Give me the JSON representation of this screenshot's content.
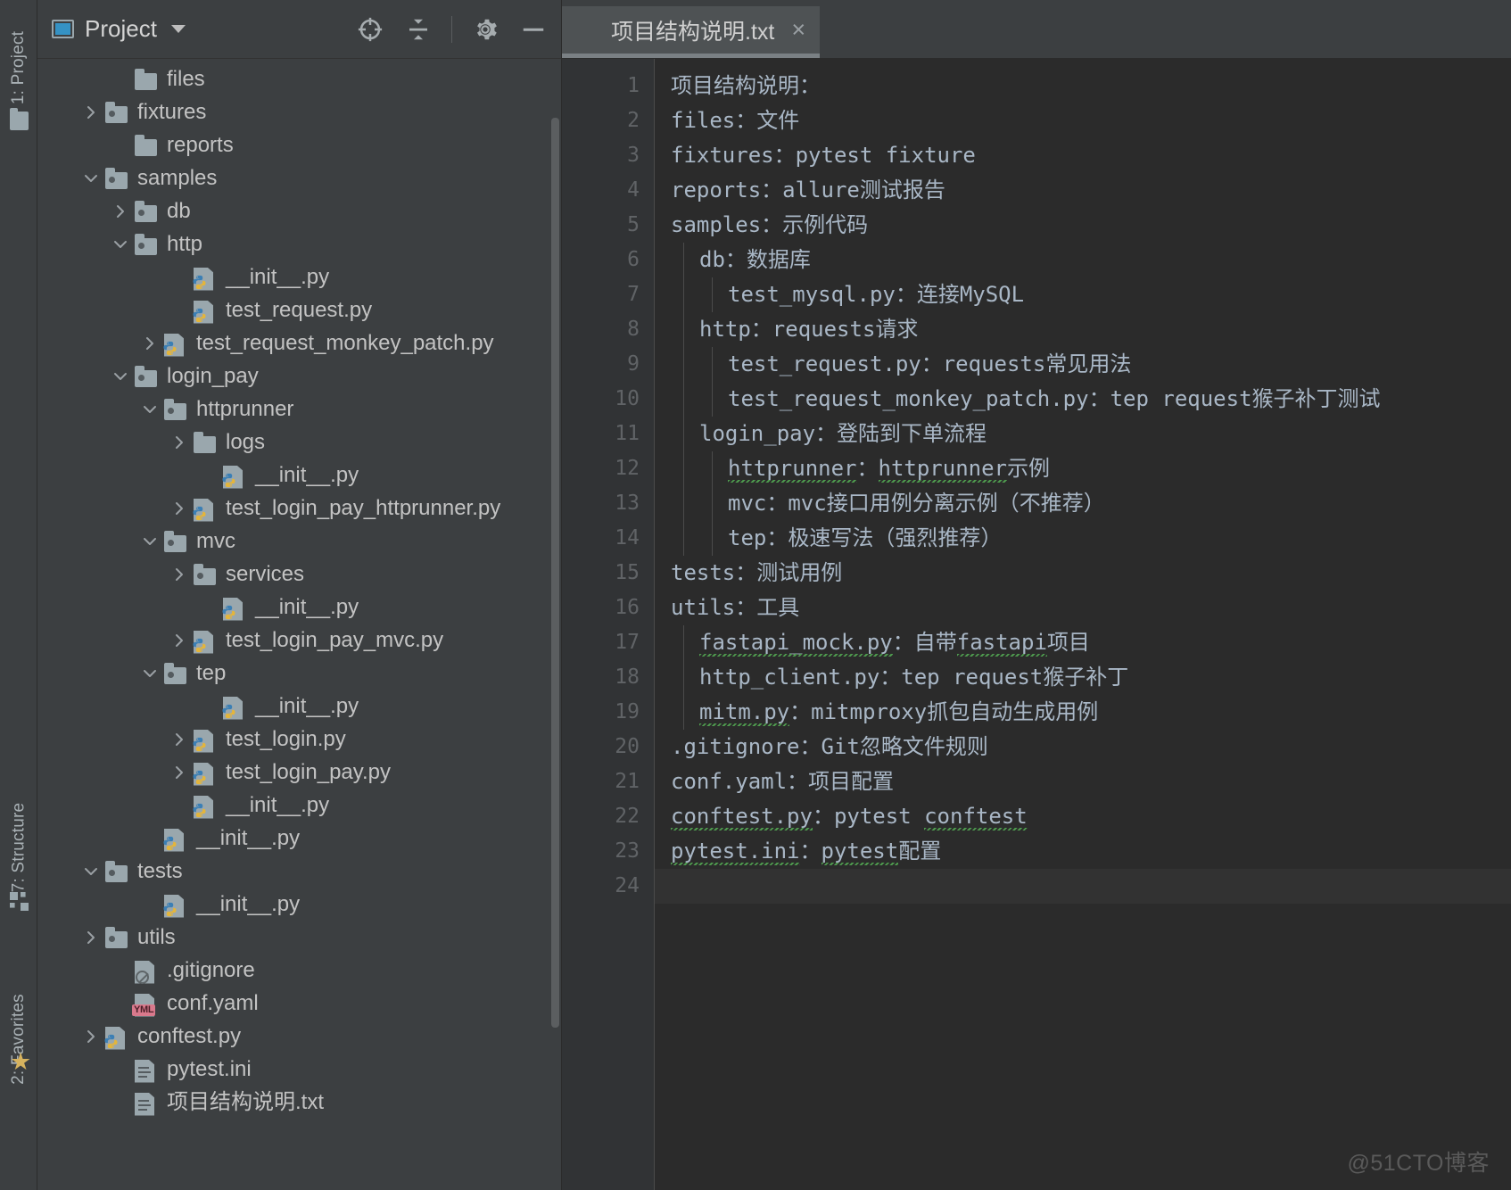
{
  "toolstrip": {
    "tabs": [
      {
        "id": "project",
        "label": "1: Project",
        "icon": "folder-icon"
      },
      {
        "id": "structure",
        "label": "7: Structure",
        "icon": "structure-icon"
      },
      {
        "id": "favorites",
        "label": "2: Favorites",
        "icon": "star-icon"
      }
    ]
  },
  "project_panel": {
    "title": "Project",
    "title_icon": "project-window-icon",
    "dropdown_icon": "chevron-down-icon",
    "actions": [
      {
        "id": "locate",
        "name": "select-opened-file-icon",
        "tooltip": "Select Opened File"
      },
      {
        "id": "collapse",
        "name": "collapse-all-icon",
        "tooltip": "Collapse All"
      },
      {
        "id": "settings",
        "name": "gear-icon",
        "tooltip": "Settings"
      },
      {
        "id": "hide",
        "name": "minimize-icon",
        "tooltip": "Hide"
      }
    ],
    "tree": [
      {
        "label": "files",
        "indent": 2,
        "arrow": "none",
        "icon": "folder-plain"
      },
      {
        "label": "fixtures",
        "indent": 1,
        "arrow": "collapsed",
        "icon": "folder-pkg"
      },
      {
        "label": "reports",
        "indent": 2,
        "arrow": "none",
        "icon": "folder-plain"
      },
      {
        "label": "samples",
        "indent": 1,
        "arrow": "expanded",
        "icon": "folder-pkg"
      },
      {
        "label": "db",
        "indent": 2,
        "arrow": "collapsed",
        "icon": "folder-pkg"
      },
      {
        "label": "http",
        "indent": 2,
        "arrow": "expanded",
        "icon": "folder-pkg"
      },
      {
        "label": "__init__.py",
        "indent": 4,
        "arrow": "none",
        "icon": "python-file"
      },
      {
        "label": "test_request.py",
        "indent": 4,
        "arrow": "none",
        "icon": "python-file"
      },
      {
        "label": "test_request_monkey_patch.py",
        "indent": 3,
        "arrow": "collapsed",
        "icon": "python-file"
      },
      {
        "label": "login_pay",
        "indent": 2,
        "arrow": "expanded",
        "icon": "folder-pkg"
      },
      {
        "label": "httprunner",
        "indent": 3,
        "arrow": "expanded",
        "icon": "folder-pkg"
      },
      {
        "label": "logs",
        "indent": 4,
        "arrow": "collapsed",
        "icon": "folder-plain"
      },
      {
        "label": "__init__.py",
        "indent": 5,
        "arrow": "none",
        "icon": "python-file"
      },
      {
        "label": "test_login_pay_httprunner.py",
        "indent": 4,
        "arrow": "collapsed",
        "icon": "python-file"
      },
      {
        "label": "mvc",
        "indent": 3,
        "arrow": "expanded",
        "icon": "folder-pkg"
      },
      {
        "label": "services",
        "indent": 4,
        "arrow": "collapsed",
        "icon": "folder-pkg"
      },
      {
        "label": "__init__.py",
        "indent": 5,
        "arrow": "none",
        "icon": "python-file"
      },
      {
        "label": "test_login_pay_mvc.py",
        "indent": 4,
        "arrow": "collapsed",
        "icon": "python-file"
      },
      {
        "label": "tep",
        "indent": 3,
        "arrow": "expanded",
        "icon": "folder-pkg"
      },
      {
        "label": "__init__.py",
        "indent": 5,
        "arrow": "none",
        "icon": "python-file"
      },
      {
        "label": "test_login.py",
        "indent": 4,
        "arrow": "collapsed",
        "icon": "python-file"
      },
      {
        "label": "test_login_pay.py",
        "indent": 4,
        "arrow": "collapsed",
        "icon": "python-file"
      },
      {
        "label": "__init__.py",
        "indent": 4,
        "arrow": "none",
        "icon": "python-file"
      },
      {
        "label": "__init__.py",
        "indent": 3,
        "arrow": "none",
        "icon": "python-file"
      },
      {
        "label": "tests",
        "indent": 1,
        "arrow": "expanded",
        "icon": "folder-pkg"
      },
      {
        "label": "__init__.py",
        "indent": 3,
        "arrow": "none",
        "icon": "python-file"
      },
      {
        "label": "utils",
        "indent": 1,
        "arrow": "collapsed",
        "icon": "folder-pkg"
      },
      {
        "label": ".gitignore",
        "indent": 2,
        "arrow": "none",
        "icon": "gitignore-file"
      },
      {
        "label": "conf.yaml",
        "indent": 2,
        "arrow": "none",
        "icon": "yaml-file"
      },
      {
        "label": "conftest.py",
        "indent": 1,
        "arrow": "collapsed",
        "icon": "python-file"
      },
      {
        "label": "pytest.ini",
        "indent": 2,
        "arrow": "none",
        "icon": "ini-file"
      },
      {
        "label": "项目结构说明.txt",
        "indent": 2,
        "arrow": "none",
        "icon": "text-file"
      }
    ]
  },
  "editor": {
    "tab": {
      "label": "项目结构说明.txt",
      "icon": "text-file-icon",
      "close_icon": "close-icon",
      "close_label": "×"
    },
    "line_numbers": [
      "1",
      "2",
      "3",
      "4",
      "5",
      "6",
      "7",
      "8",
      "9",
      "10",
      "11",
      "12",
      "13",
      "14",
      "15",
      "16",
      "17",
      "18",
      "19",
      "20",
      "21",
      "22",
      "23",
      "24"
    ],
    "lines": [
      {
        "n": 1,
        "indent": 0,
        "text": "项目结构说明："
      },
      {
        "n": 2,
        "indent": 0,
        "text": "files：文件"
      },
      {
        "n": 3,
        "indent": 0,
        "text": "fixtures：pytest fixture"
      },
      {
        "n": 4,
        "indent": 0,
        "text": "reports：allure测试报告"
      },
      {
        "n": 5,
        "indent": 0,
        "text": "samples：示例代码"
      },
      {
        "n": 6,
        "indent": 1,
        "text": "db：数据库"
      },
      {
        "n": 7,
        "indent": 2,
        "text": "test_mysql.py：连接MySQL"
      },
      {
        "n": 8,
        "indent": 1,
        "text": "http：requests请求"
      },
      {
        "n": 9,
        "indent": 2,
        "text": "test_request.py：requests常见用法"
      },
      {
        "n": 10,
        "indent": 2,
        "text": "test_request_monkey_patch.py：tep request猴子补丁测试"
      },
      {
        "n": 11,
        "indent": 1,
        "text": "login_pay：登陆到下单流程"
      },
      {
        "n": 12,
        "indent": 2,
        "text": "httprunner：httprunner示例"
      },
      {
        "n": 13,
        "indent": 2,
        "text": "mvc：mvc接口用例分离示例（不推荐）"
      },
      {
        "n": 14,
        "indent": 2,
        "text": "tep：极速写法（强烈推荐）"
      },
      {
        "n": 15,
        "indent": 0,
        "text": "tests：测试用例"
      },
      {
        "n": 16,
        "indent": 0,
        "text": "utils：工具"
      },
      {
        "n": 17,
        "indent": 1,
        "text": "fastapi_mock.py：自带fastapi项目"
      },
      {
        "n": 18,
        "indent": 1,
        "text": "http_client.py：tep request猴子补丁"
      },
      {
        "n": 19,
        "indent": 1,
        "text": "mitm.py：mitmproxy抓包自动生成用例"
      },
      {
        "n": 20,
        "indent": 0,
        "text": ".gitignore：Git忽略文件规则"
      },
      {
        "n": 21,
        "indent": 0,
        "text": "conf.yaml：项目配置"
      },
      {
        "n": 22,
        "indent": 0,
        "text": "conftest.py：pytest conftest"
      },
      {
        "n": 23,
        "indent": 0,
        "text": "pytest.ini：pytest配置"
      },
      {
        "n": 24,
        "indent": 0,
        "text": ""
      }
    ]
  },
  "watermark": {
    "text": "@51CTO博客"
  },
  "colors": {
    "panel_bg": "#3c3f41",
    "editor_bg": "#2b2b2b",
    "gutter_bg": "#313335",
    "code_text": "#a9b7c6",
    "tree_text": "#c3c3c3",
    "accent_blue": "#3592c4",
    "tab_active": "#4e5254",
    "tab_underline": "#7a8084",
    "squiggle_green": "#4e9a4e",
    "yaml_badge": "#d9798c"
  }
}
